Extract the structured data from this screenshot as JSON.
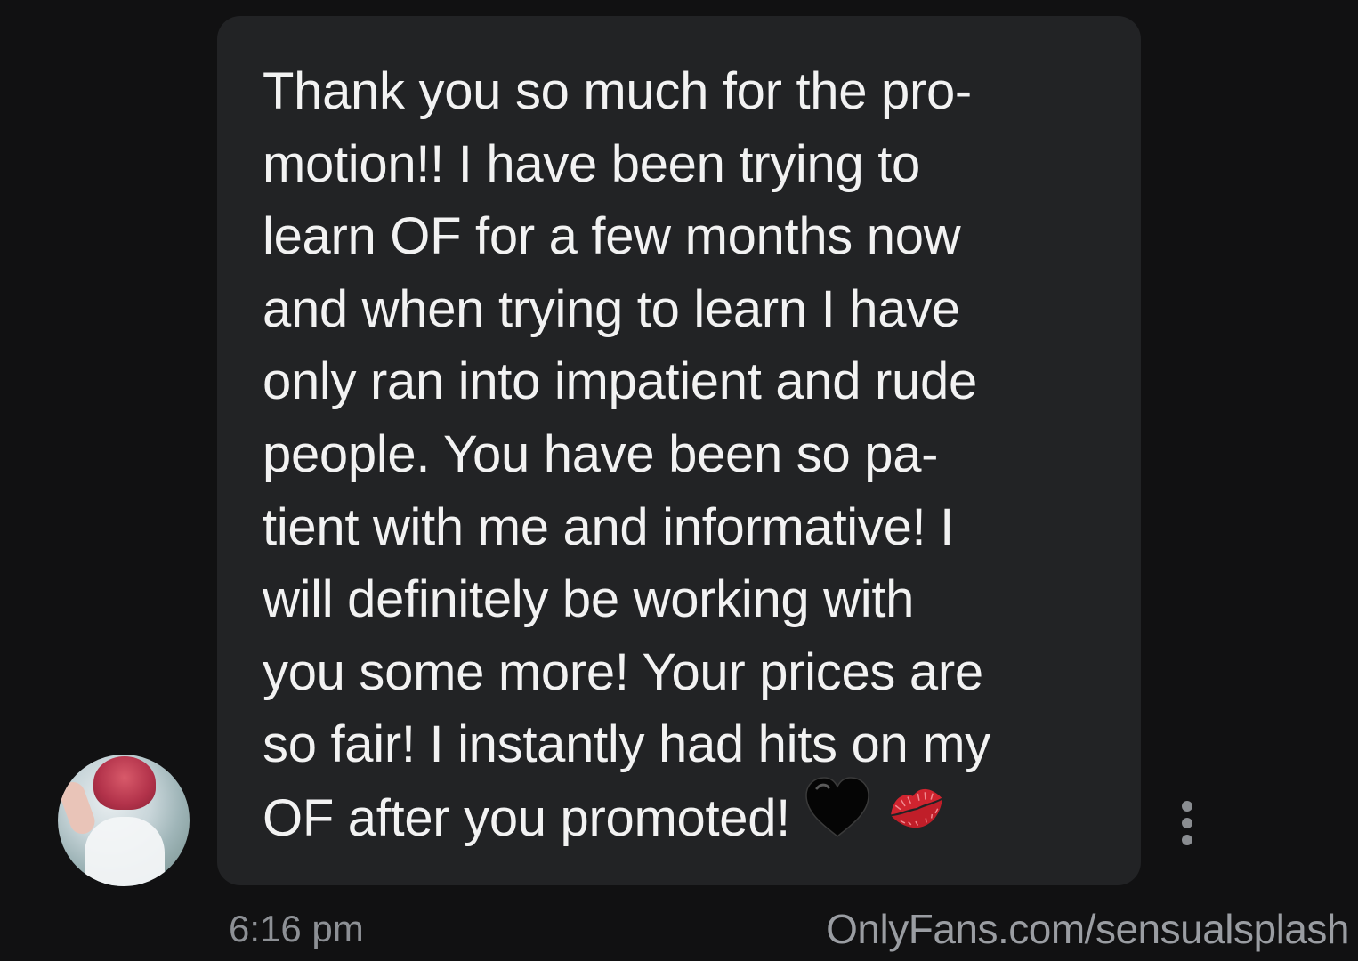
{
  "message": {
    "lines": [
      "Thank you so much for the pro-",
      "motion!! I have been trying to",
      "learn OF for a few months now",
      "and when trying to learn I have",
      "only ran into impatient and rude",
      "people. You have been so pa-",
      "tient with me and informative! I",
      "will definitely be working with",
      "you some more! Your prices are",
      "so fair! I instantly had hits on my",
      "OF after you promoted!"
    ],
    "emojis": [
      "black-heart",
      "kiss-mark"
    ]
  },
  "timestamp": "6:16 pm",
  "watermark": "OnlyFans.com/sensualsplash",
  "colors": {
    "background": "#111112",
    "bubble": "#222325",
    "text": "#f2f2f2",
    "muted": "#8d9095",
    "lips": "#d0242f"
  }
}
